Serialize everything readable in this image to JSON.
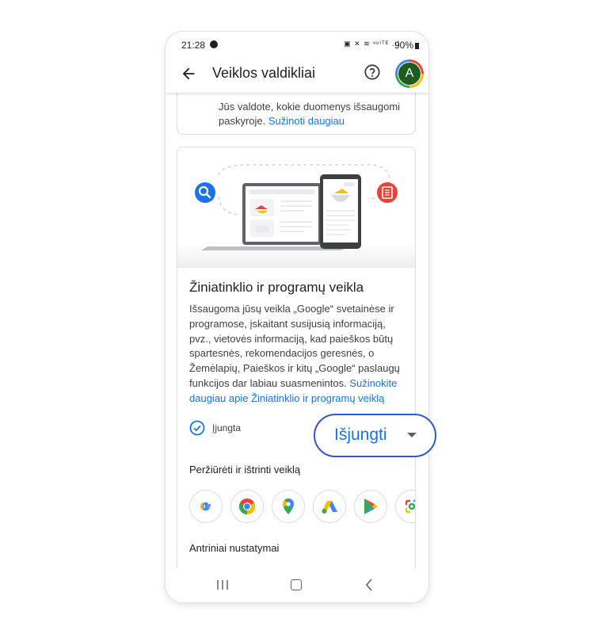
{
  "status_bar": {
    "time": "21:28",
    "icons": "▣ ✕ ≋ ᵛᵒˡᵀᴱ .ıl",
    "battery": "90%"
  },
  "appbar": {
    "title": "Veiklos valdikliai",
    "avatar_letter": "A"
  },
  "top_card": {
    "text": "Jūs valdote, kokie duomenys išsaugomi paskyroje.",
    "link": "Sužinoti daugiau"
  },
  "activity_card": {
    "title": "Žiniatinklio ir programų veikla",
    "description": "Išsaugoma jūsų veikla „Google“ svetainėse ir programose, įskaitant susijusią informaciją, pvz., vietovės informaciją, kad paieškos būtų spartesnės, rekomendacijos geresnės, o Žemėlapių, Paieškos ir kitų „Google“ paslaugų funkcijos dar labiau suasmenintos.",
    "link": "Sužinokite daugiau apie Žiniatinklio ir programų veiklą",
    "status": "Įjungta",
    "turn_off_label": "Išjungti",
    "view_delete_label": "Peržiūrėti ir ištrinti veiklą",
    "sub_settings_label": "Antriniai nustatymai"
  },
  "apps": [
    {
      "name": "Google",
      "icon": "google-icon"
    },
    {
      "name": "Chrome",
      "icon": "chrome-icon"
    },
    {
      "name": "Maps",
      "icon": "maps-icon"
    },
    {
      "name": "Google Ads",
      "icon": "ads-icon"
    },
    {
      "name": "Google Play",
      "icon": "play-icon"
    },
    {
      "name": "Lens",
      "icon": "lens-icon"
    }
  ],
  "colors": {
    "accent": "#1a73e8",
    "highlight_ring": "#3056d3",
    "avatar_bg": "#1e5c1e"
  }
}
